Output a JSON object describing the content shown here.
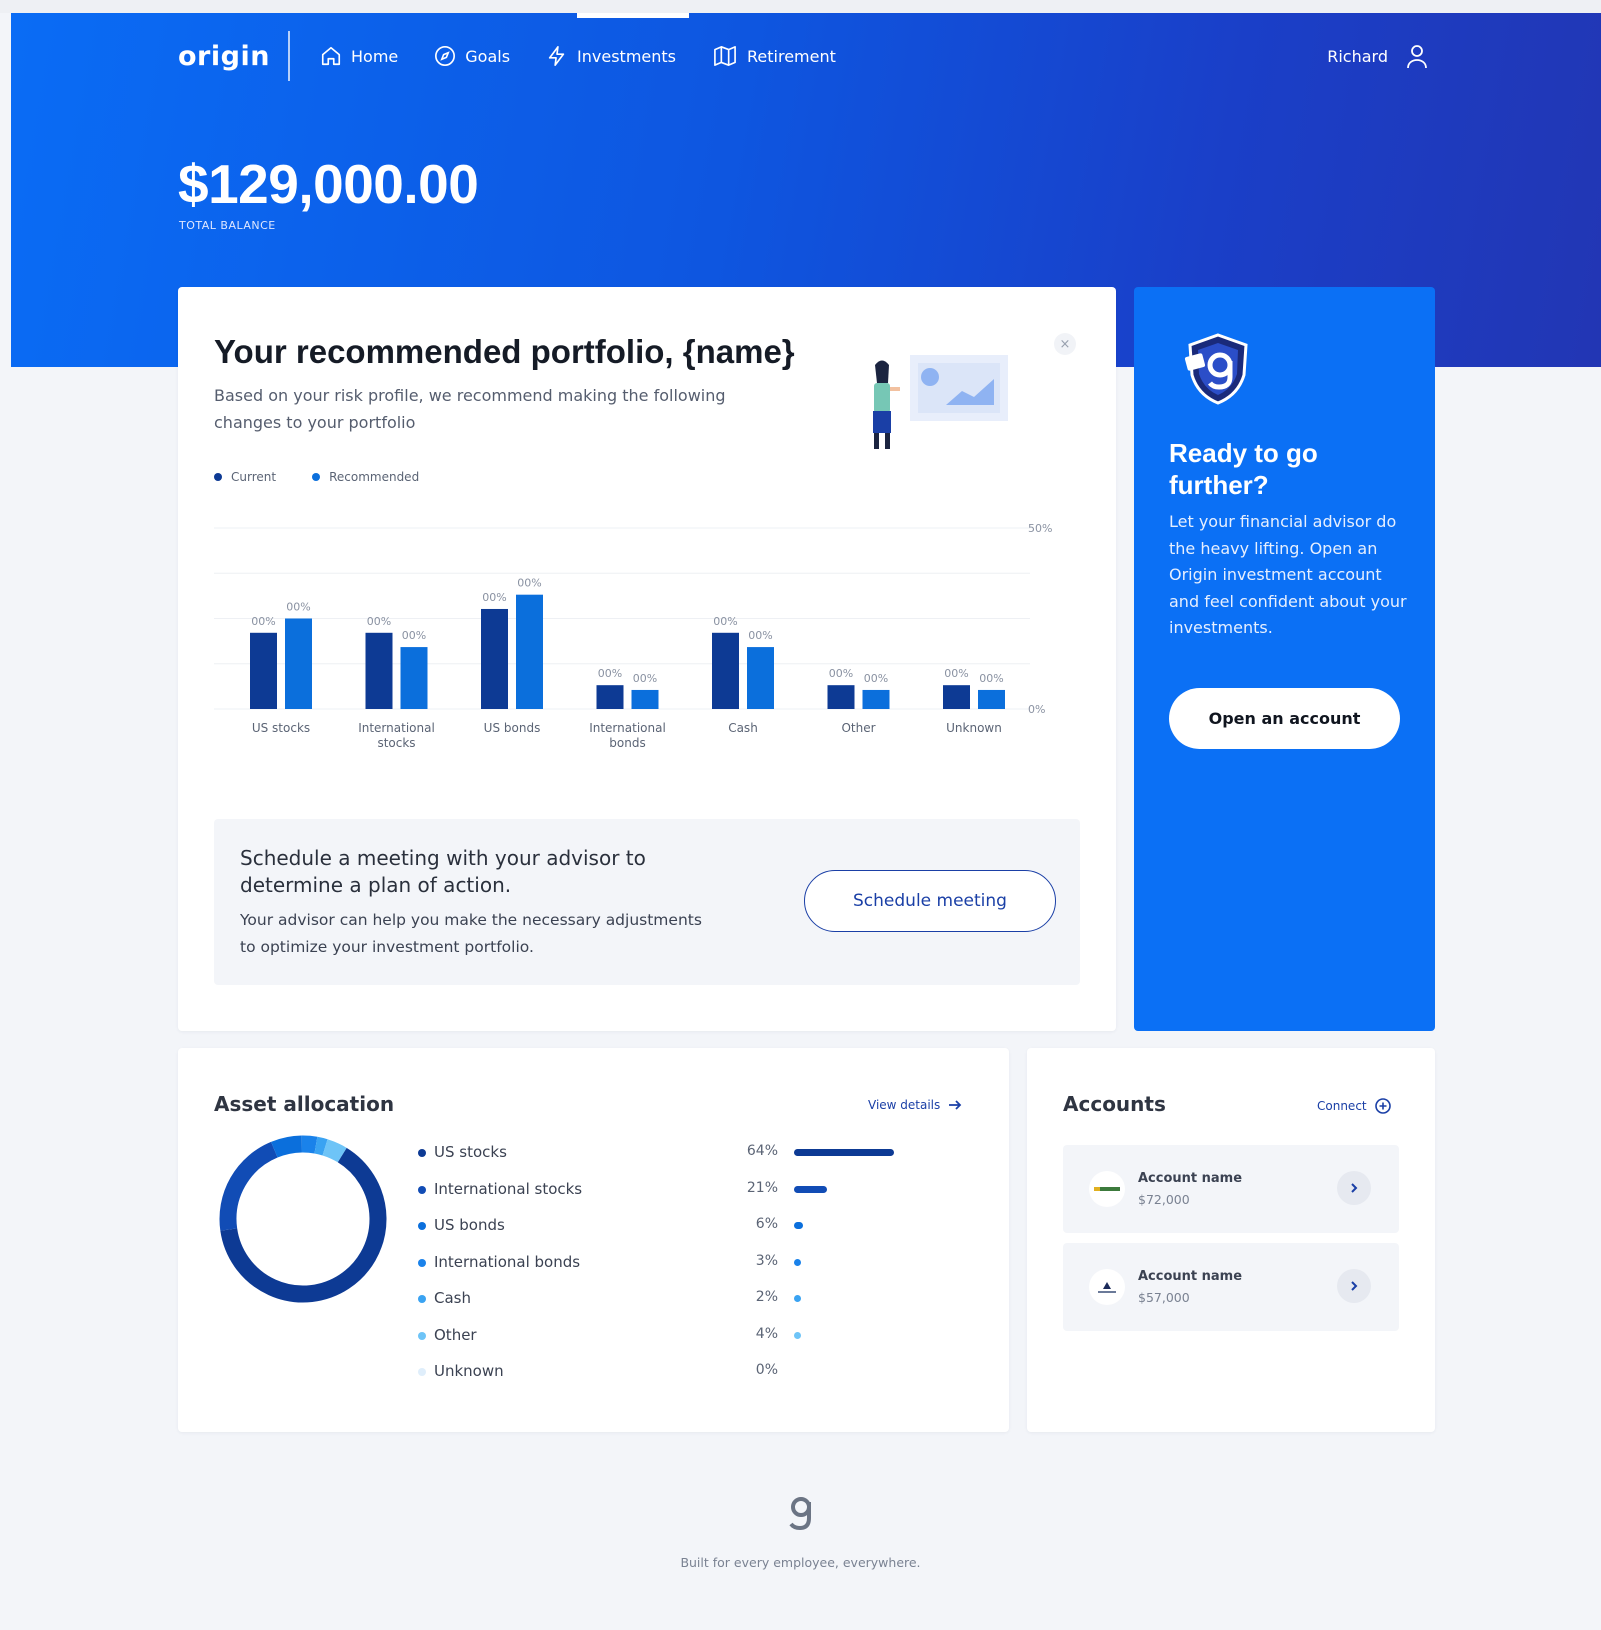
{
  "app": {
    "logo": "origin"
  },
  "nav": {
    "items": [
      {
        "label": "Home",
        "icon": "home-icon"
      },
      {
        "label": "Goals",
        "icon": "compass-icon"
      },
      {
        "label": "Investments",
        "icon": "lightning-icon"
      },
      {
        "label": "Retirement",
        "icon": "map-icon"
      }
    ],
    "user": "Richard"
  },
  "balance": {
    "amount": "$129,000.00",
    "label": "TOTAL BALANCE"
  },
  "recommendation": {
    "title": "Your recommended portfolio, {name}",
    "subtitle": "Based on your risk profile, we recommend making the following changes to your portfolio",
    "close": "×",
    "legend": [
      {
        "label": "Current",
        "color": "#0d3a94"
      },
      {
        "label": "Recommended",
        "color": "#0b6fdc"
      }
    ]
  },
  "chart_data": {
    "type": "bar",
    "categories": [
      [
        "US stocks"
      ],
      [
        "International",
        "stocks"
      ],
      [
        "US bonds"
      ],
      [
        "International",
        "bonds"
      ],
      [
        "Cash"
      ],
      [
        "Other"
      ],
      [
        "Unknown"
      ]
    ],
    "series": [
      {
        "name": "Current",
        "values": [
          16,
          16,
          21,
          5,
          16,
          5,
          5
        ],
        "labels": [
          "00%",
          "00%",
          "00%",
          "00%",
          "00%",
          "00%",
          "00%"
        ],
        "color": "#0d3a94"
      },
      {
        "name": "Recommended",
        "values": [
          19,
          13,
          24,
          4,
          13,
          4,
          4
        ],
        "labels": [
          "00%",
          "00%",
          "00%",
          "00%",
          "00%",
          "00%",
          "00%"
        ],
        "color": "#0b6fdc"
      }
    ],
    "ylim": [
      0,
      38
    ],
    "yticks": [
      {
        "value": 38,
        "label": "50%"
      },
      {
        "value": 0,
        "label": "0%"
      }
    ],
    "grid": true
  },
  "meeting": {
    "title": "Schedule a meeting with your advisor to determine a plan of action.",
    "text": "Your advisor can help you make the necessary adjustments to optimize your investment portfolio.",
    "button": "Schedule meeting"
  },
  "promo": {
    "title": "Ready to go further?",
    "text": "Let your financial advisor do the heavy lifting. Open an Origin investment account and feel confident about your investments.",
    "button": "Open an account"
  },
  "allocation": {
    "title": "Asset allocation",
    "link": "View details",
    "items": [
      {
        "name": "US stocks",
        "pct": "64%",
        "value": 64,
        "color": "#0d3a94"
      },
      {
        "name": "International stocks",
        "pct": "21%",
        "value": 21,
        "color": "#114cb5"
      },
      {
        "name": "US bonds",
        "pct": "6%",
        "value": 6,
        "color": "#0b6fdc"
      },
      {
        "name": "International bonds",
        "pct": "3%",
        "value": 3,
        "color": "#1a82ea"
      },
      {
        "name": "Cash",
        "pct": "2%",
        "value": 2,
        "color": "#3aa3f2"
      },
      {
        "name": "Other",
        "pct": "4%",
        "value": 4,
        "color": "#6ec4f7"
      },
      {
        "name": "Unknown",
        "pct": "0%",
        "value": 0,
        "color": "#dfeefb"
      }
    ]
  },
  "accounts": {
    "title": "Accounts",
    "link": "Connect",
    "items": [
      {
        "name": "Account name",
        "value": "$72,000"
      },
      {
        "name": "Account name",
        "value": "$57,000"
      }
    ]
  },
  "footer": {
    "text": "Built for every employee, everywhere."
  }
}
